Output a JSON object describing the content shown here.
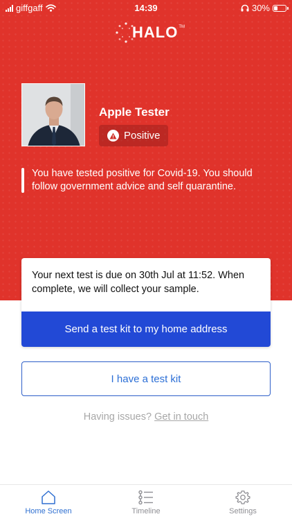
{
  "status_bar": {
    "carrier": "giffgaff",
    "time": "14:39",
    "battery_percent": "30%",
    "battery_level": 0.3,
    "icons": [
      "signal-icon",
      "wifi-icon",
      "headphones-icon",
      "battery-icon"
    ]
  },
  "brand": {
    "name": "HALO",
    "trademark": "TM"
  },
  "profile": {
    "name": "Apple Tester",
    "status_label": "Positive",
    "status_icon": "warning-icon"
  },
  "notice": {
    "text": "You have tested positive for Covid-19. You should follow government advice and self quarantine."
  },
  "test_card": {
    "message": "Your next test is due on 30th Jul at 11:52. When complete, we will collect your sample.",
    "primary_button": "Send a test kit to my home address"
  },
  "secondary_button": "I have a test kit",
  "help": {
    "prefix": "Having issues?",
    "link": "Get in touch"
  },
  "tabs": [
    {
      "label": "Home Screen",
      "icon": "home-icon",
      "active": true
    },
    {
      "label": "Timeline",
      "icon": "list-icon",
      "active": false
    },
    {
      "label": "Settings",
      "icon": "gear-icon",
      "active": false
    }
  ],
  "colors": {
    "hero": "#e0332b",
    "primary": "#2249d6",
    "link": "#2c6fd6",
    "tab_active": "#2e6fd1",
    "tab_inactive": "#8e8e93"
  }
}
